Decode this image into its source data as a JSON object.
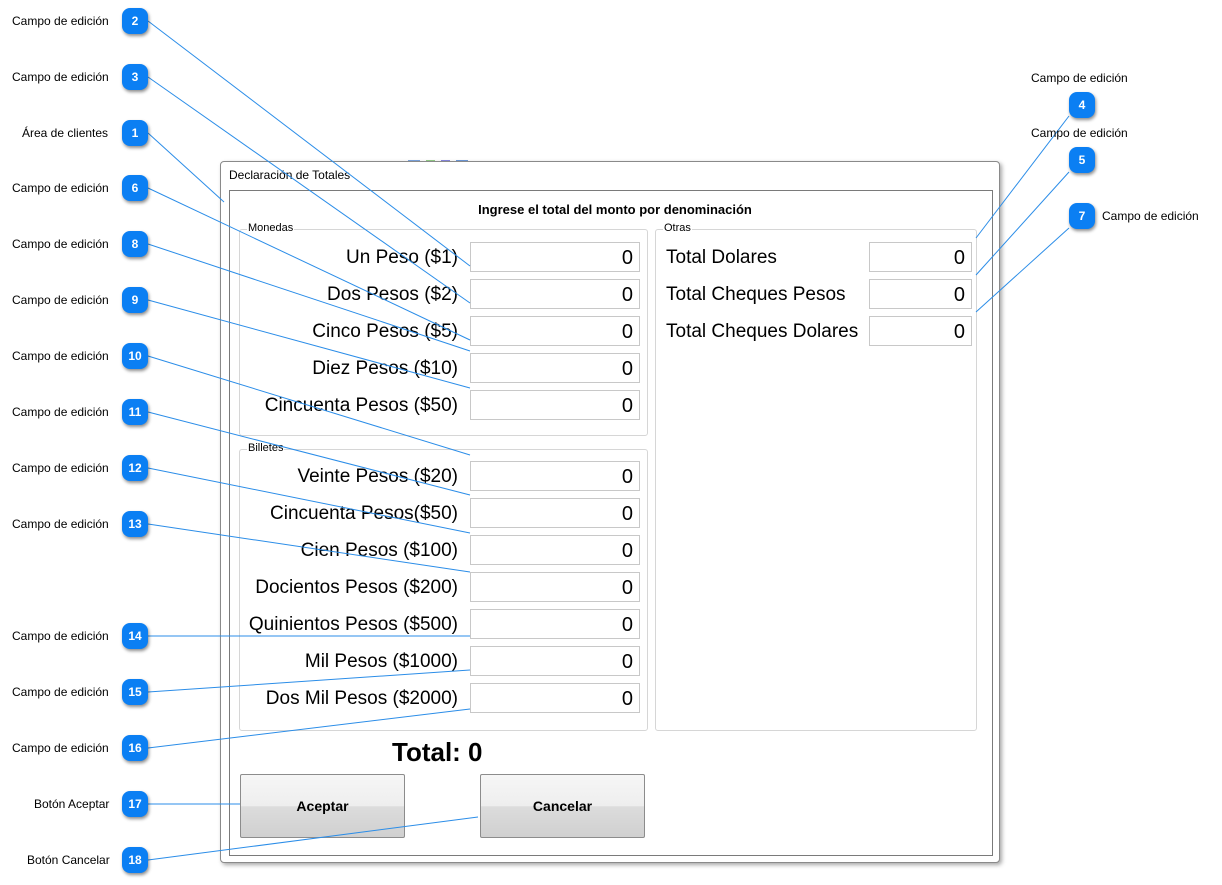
{
  "dialog": {
    "title": "Declaración de Totales",
    "heading": "Ingrese el total del monto por denominación"
  },
  "monedas": {
    "label": "Monedas",
    "rows": [
      {
        "label": "Un Peso ($1)",
        "value": "0"
      },
      {
        "label": "Dos Pesos ($2)",
        "value": "0"
      },
      {
        "label": "Cinco Pesos ($5)",
        "value": "0"
      },
      {
        "label": "Diez Pesos ($10)",
        "value": "0"
      },
      {
        "label": "Cincuenta Pesos ($50)",
        "value": "0"
      }
    ]
  },
  "billetes": {
    "label": "Billetes",
    "rows": [
      {
        "label": "Veinte Pesos ($20)",
        "value": "0"
      },
      {
        "label": "Cincuenta Pesos($50)",
        "value": "0"
      },
      {
        "label": "Cien Pesos ($100)",
        "value": "0"
      },
      {
        "label": "Docientos Pesos ($200)",
        "value": "0"
      },
      {
        "label": "Quinientos Pesos ($500)",
        "value": "0"
      },
      {
        "label": "Mil Pesos ($1000)",
        "value": "0"
      },
      {
        "label": "Dos Mil Pesos ($2000)",
        "value": "0"
      }
    ]
  },
  "otras": {
    "label": "Otras",
    "rows": [
      {
        "label": "Total Dolares",
        "value": "0"
      },
      {
        "label": "Total Cheques Pesos",
        "value": "0"
      },
      {
        "label": "Total Cheques Dolares",
        "value": "0"
      }
    ]
  },
  "total": "Total: 0",
  "buttons": {
    "accept": "Aceptar",
    "cancel": "Cancelar"
  },
  "annotations": [
    {
      "num": "2",
      "label": "Campo de edición"
    },
    {
      "num": "3",
      "label": "Campo de edición"
    },
    {
      "num": "1",
      "label": "Área de clientes"
    },
    {
      "num": "6",
      "label": "Campo de edición"
    },
    {
      "num": "8",
      "label": "Campo de edición"
    },
    {
      "num": "9",
      "label": "Campo de edición"
    },
    {
      "num": "10",
      "label": "Campo de edición"
    },
    {
      "num": "11",
      "label": "Campo de edición"
    },
    {
      "num": "12",
      "label": "Campo de edición"
    },
    {
      "num": "13",
      "label": "Campo de edición"
    },
    {
      "num": "14",
      "label": "Campo de edición"
    },
    {
      "num": "15",
      "label": "Campo de edición"
    },
    {
      "num": "16",
      "label": "Campo de edición"
    },
    {
      "num": "17",
      "label": "Botón Aceptar"
    },
    {
      "num": "18",
      "label": "Botón Cancelar"
    },
    {
      "num": "4",
      "label": "Campo de edición"
    },
    {
      "num": "5",
      "label": "Campo de edición"
    },
    {
      "num": "7",
      "label": "Campo de edición"
    }
  ],
  "colors": {
    "badge": "#0b7ff3",
    "callout_line": "#2b8de8"
  }
}
